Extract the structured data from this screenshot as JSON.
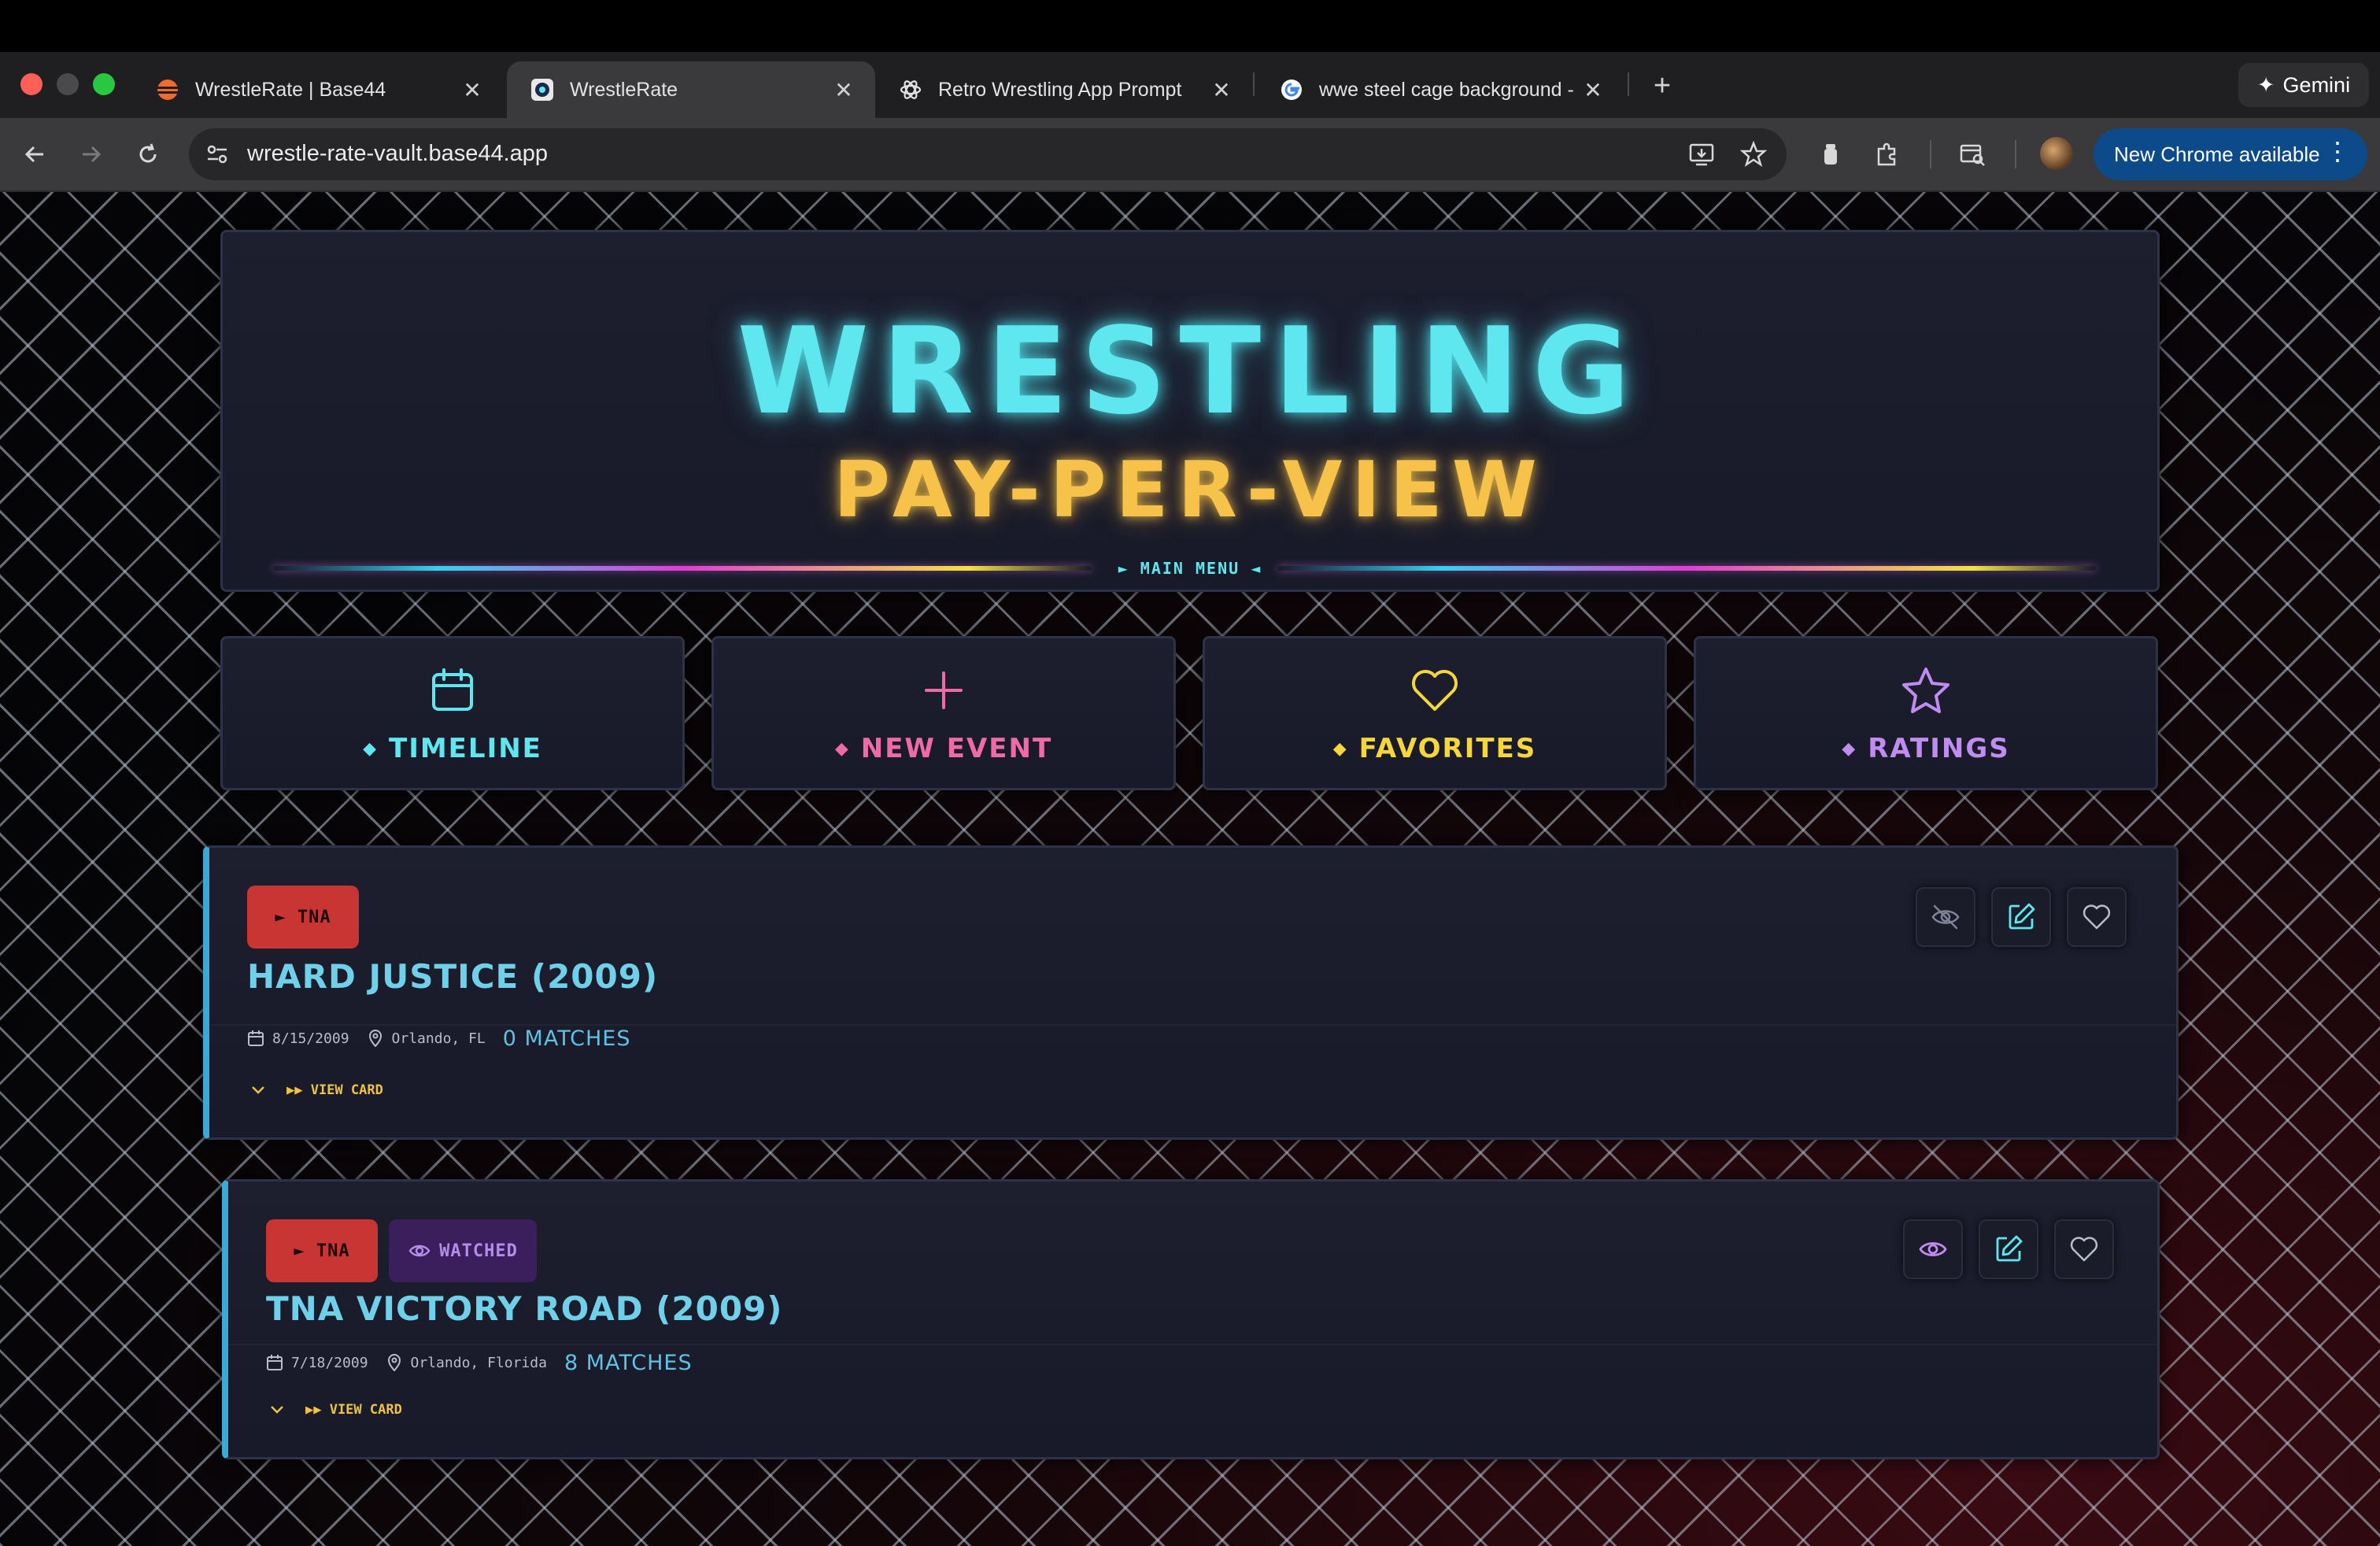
{
  "browser": {
    "tabs": [
      {
        "title": "WrestleRate | Base44",
        "favicon": "base44-icon",
        "active": false
      },
      {
        "title": "WrestleRate",
        "favicon": "wrestlerate-icon",
        "active": true
      },
      {
        "title": "Retro Wrestling App Prompt",
        "favicon": "chatgpt-icon",
        "active": false
      },
      {
        "title": "wwe steel cage background -",
        "favicon": "google-icon",
        "active": false
      }
    ],
    "close_glyph": "✕",
    "new_tab_glyph": "+",
    "gemini_label": "Gemini",
    "url": "wrestle-rate-vault.base44.app",
    "update_label": "New Chrome available"
  },
  "hero": {
    "title": "WRESTLING",
    "subtitle": "PAY-PER-VIEW",
    "menu_label": "► MAIN MENU ◄"
  },
  "nav": [
    {
      "label": "TIMELINE",
      "icon": "calendar-icon",
      "color": "#5ee7ef"
    },
    {
      "label": "NEW EVENT",
      "icon": "plus-icon",
      "color": "#f06aa8"
    },
    {
      "label": "FAVORITES",
      "icon": "heart-icon",
      "color": "#f6d63a"
    },
    {
      "label": "RATINGS",
      "icon": "star-icon",
      "color": "#c08cf0"
    }
  ],
  "events": [
    {
      "promotion": "► TNA",
      "watched": false,
      "title": "HARD JUSTICE (2009)",
      "date": "8/15/2009",
      "location": "Orlando, FL",
      "matches": "0 MATCHES",
      "view_card": "▶▶ VIEW CARD"
    },
    {
      "promotion": "► TNA",
      "watched": true,
      "watched_label": "WATCHED",
      "title": "TNA VICTORY ROAD (2009)",
      "date": "7/18/2009",
      "location": "Orlando, Florida",
      "matches": "8 MATCHES",
      "view_card": "▶▶ VIEW CARD"
    }
  ],
  "colors": {
    "accent_cyan": "#5ee7ef",
    "accent_gold": "#f6c24a",
    "badge_red": "#c83532",
    "watched_purple": "#3a1f5c"
  }
}
